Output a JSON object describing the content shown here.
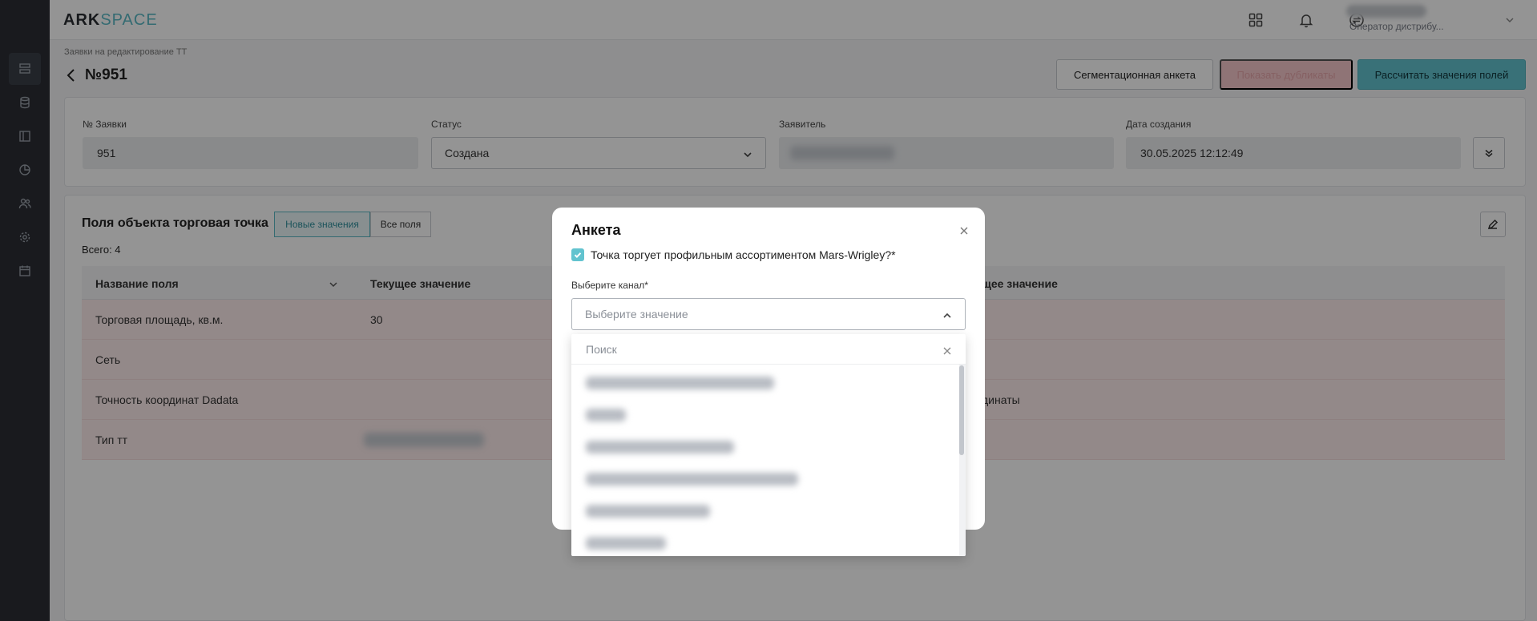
{
  "app": {
    "logo_ark": "ARK",
    "logo_space": "SPACE",
    "user_role": "Оператор дистрибу..."
  },
  "page": {
    "breadcrumb": "Заявки на редактирование ТТ",
    "title": "№951",
    "buttons": {
      "segmentation": "Сегментационная анкета",
      "duplicates": "Показать дубликаты",
      "calculate": "Рассчитать значения полей"
    }
  },
  "request": {
    "number_label": "№ Заявки",
    "number_value": "951",
    "status_label": "Статус",
    "status_value": "Создана",
    "applicant_label": "Заявитель",
    "date_label": "Дата создания",
    "date_value": "30.05.2025 12:12:49"
  },
  "fields_section": {
    "title": "Поля объекта торговая точка",
    "tab_new": "Новые значения",
    "tab_all": "Все поля",
    "total": "Всего: 4",
    "columns": [
      "Название поля",
      "Текущее значение",
      "щее значение"
    ],
    "rows": [
      {
        "name": "Торговая площадь, кв.м.",
        "current": "30",
        "new": ""
      },
      {
        "name": "Сеть",
        "current": "",
        "new": ""
      },
      {
        "name": "Точность координат Dadata",
        "current": "",
        "new": "динаты"
      },
      {
        "name": "Тип тт",
        "current": "",
        "new": ""
      }
    ]
  },
  "modal": {
    "title": "Анкета",
    "checkbox_label": "Точка торгует профильным ассортиментом Mars-Wrigley?*",
    "channel_label": "Выберите канал*",
    "channel_placeholder": "Выберите значение",
    "search_placeholder": "Поиск"
  },
  "colors": {
    "accent": "#62c3cf",
    "sidebar": "#2b2e35",
    "row_highlight": "#fdecec"
  }
}
